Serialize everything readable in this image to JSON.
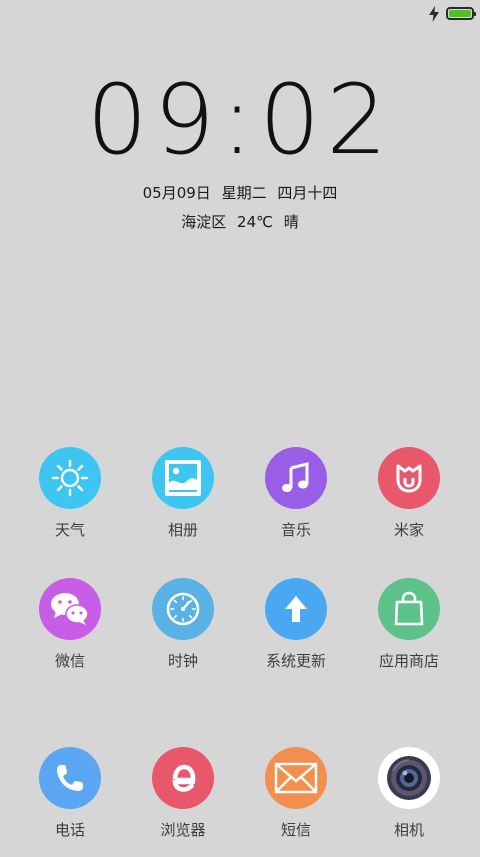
{
  "status_bar": {
    "battery_level": 1.0,
    "charging": true,
    "battery_color": "#4fc21d"
  },
  "lockscreen": {
    "time": "09:02",
    "date": "05月09日",
    "weekday": "星期二",
    "lunar_date": "四月十四",
    "location": "海淀区",
    "temperature": "24℃",
    "condition": "晴"
  },
  "apps": [
    {
      "label": "天气",
      "icon": "sun-icon",
      "color": "#3ec6f2"
    },
    {
      "label": "相册",
      "icon": "gallery-icon",
      "color": "#3ec6f2"
    },
    {
      "label": "音乐",
      "icon": "music-note-icon",
      "color": "#9a5ee6"
    },
    {
      "label": "米家",
      "icon": "mijia-icon",
      "color": "#e8576a"
    },
    {
      "label": "微信",
      "icon": "wechat-icon",
      "color": "#c75ce6"
    },
    {
      "label": "时钟",
      "icon": "clock-icon",
      "color": "#58b2e6"
    },
    {
      "label": "系统更新",
      "icon": "arrow-up-icon",
      "color": "#4aa8f0"
    },
    {
      "label": "应用商店",
      "icon": "shopping-bag-icon",
      "color": "#5cc28a"
    }
  ],
  "dock": [
    {
      "label": "电话",
      "icon": "phone-icon",
      "color": "#5aa6f2"
    },
    {
      "label": "浏览器",
      "icon": "browser-icon",
      "color": "#e8576a"
    },
    {
      "label": "短信",
      "icon": "envelope-icon",
      "color": "#f28f4e"
    },
    {
      "label": "相机",
      "icon": "camera-lens-icon",
      "color": "#ffffff"
    }
  ]
}
